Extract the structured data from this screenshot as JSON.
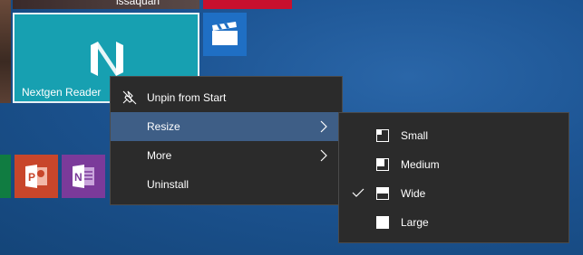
{
  "tiles": {
    "people_name": "issaquah",
    "nextgen_label": "Nextgen Reader"
  },
  "icons": {
    "unpin": "unpin-icon",
    "chevron": "chevron-right-icon",
    "check": "checkmark-icon",
    "small": "tile-size-small-icon",
    "medium": "tile-size-medium-icon",
    "wide": "tile-size-wide-icon",
    "large": "tile-size-large-icon",
    "nextgen_logo": "nextgen-reader-logo-icon",
    "movies": "movies-tv-icon",
    "powerpoint": "powerpoint-icon",
    "onenote": "onenote-icon"
  },
  "colors": {
    "accent_hover": "#3e5e86",
    "menu_bg": "#2b2b2b",
    "nextgen_tile": "#17a0b1"
  },
  "context_menu": {
    "items": [
      {
        "label": "Unpin from Start"
      },
      {
        "label": "Resize"
      },
      {
        "label": "More"
      },
      {
        "label": "Uninstall"
      }
    ]
  },
  "resize_menu": {
    "items": [
      {
        "label": "Small"
      },
      {
        "label": "Medium"
      },
      {
        "label": "Wide"
      },
      {
        "label": "Large"
      }
    ],
    "selected": "Wide"
  }
}
